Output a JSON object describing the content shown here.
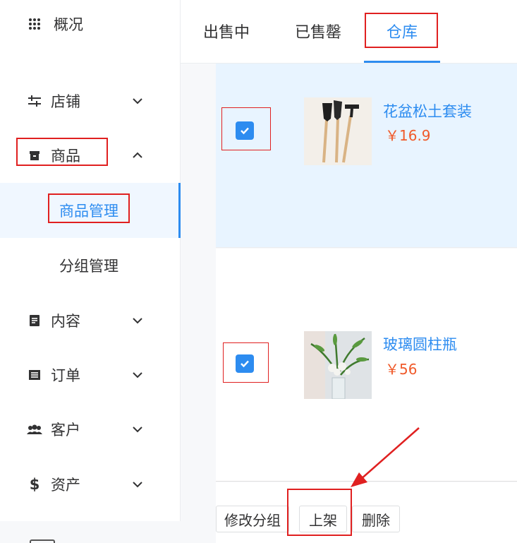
{
  "sidebar": {
    "items": [
      {
        "label": "概况",
        "icon": "grid-dots-icon"
      },
      {
        "label": "店铺",
        "icon": "sliders-icon"
      },
      {
        "label": "商品",
        "icon": "box-icon"
      },
      {
        "label": "内容",
        "icon": "document-icon"
      },
      {
        "label": "订单",
        "icon": "list-icon"
      },
      {
        "label": "客户",
        "icon": "users-icon"
      },
      {
        "label": "资产",
        "icon": "dollar-icon"
      }
    ],
    "sub_items": [
      {
        "label": "商品管理",
        "active": true
      },
      {
        "label": "分组管理",
        "active": false
      }
    ]
  },
  "tabs": [
    {
      "label": "出售中",
      "active": false
    },
    {
      "label": "已售罄",
      "active": false
    },
    {
      "label": "仓库",
      "active": true
    }
  ],
  "products": [
    {
      "name": "花盆松土套装",
      "price": "￥16.9",
      "checked": true,
      "image": "garden-tools-image"
    },
    {
      "name": "玻璃圆柱瓶",
      "price": "￥56",
      "checked": true,
      "image": "glass-vase-image"
    }
  ],
  "actions": {
    "edit_group": "修改分组",
    "list": "上架",
    "delete": "删除"
  },
  "colors": {
    "accent": "#2d8cf0",
    "price": "#f05a2a",
    "annotation": "#e02020",
    "selected_row": "#e8f4ff"
  }
}
